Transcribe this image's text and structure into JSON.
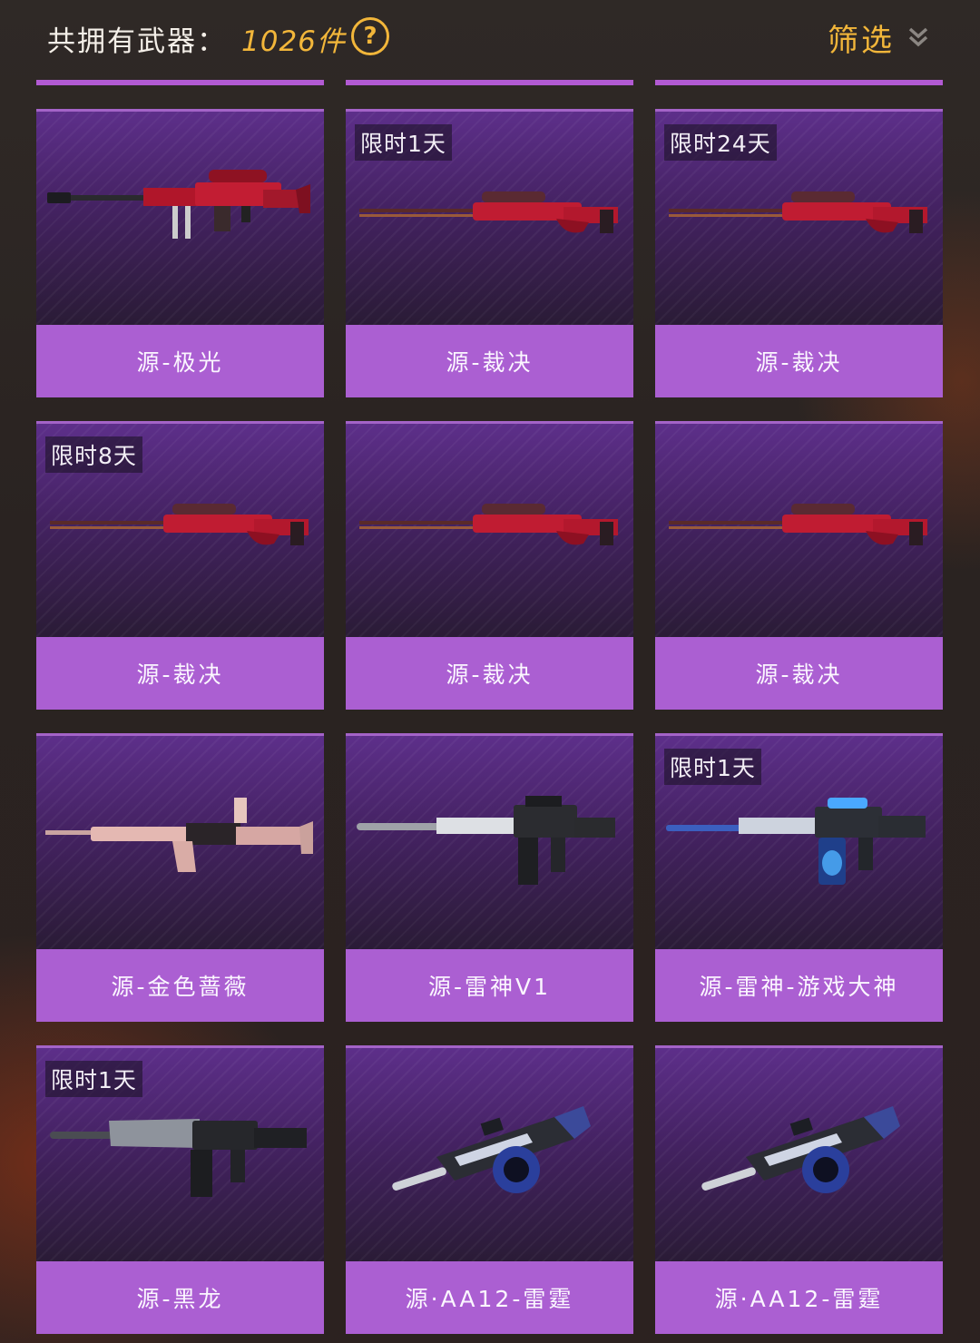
{
  "header": {
    "count_label": "共拥有武器：",
    "count_value": "1026件",
    "help_symbol": "?",
    "filter_label": "筛选"
  },
  "colors": {
    "accent_gold": "#f2b63a",
    "card_name_bg": "#ab5fd2",
    "card_top_bg": "#5d2f8a"
  },
  "weapons": [
    {
      "name": "源-极光",
      "badge": "",
      "icon": "red-heavy-sniper-rifle"
    },
    {
      "name": "源-裁决",
      "badge": "限时1天",
      "icon": "red-sniper-rifle"
    },
    {
      "name": "源-裁决",
      "badge": "限时24天",
      "icon": "red-sniper-rifle"
    },
    {
      "name": "源-裁决",
      "badge": "限时8天",
      "icon": "red-sniper-rifle"
    },
    {
      "name": "源-裁决",
      "badge": "",
      "icon": "red-sniper-rifle"
    },
    {
      "name": "源-裁决",
      "badge": "",
      "icon": "red-sniper-rifle"
    },
    {
      "name": "源-金色蔷薇",
      "badge": "",
      "icon": "rose-gold-assault-rifle"
    },
    {
      "name": "源-雷神V1",
      "badge": "",
      "icon": "dark-silver-assault-rifle"
    },
    {
      "name": "源-雷神-游戏大神",
      "badge": "限时1天",
      "icon": "blue-silver-assault-rifle"
    },
    {
      "name": "源-黑龙",
      "badge": "限时1天",
      "icon": "black-dragon-assault-rifle"
    },
    {
      "name": "源·AA12-雷霆",
      "badge": "",
      "icon": "blue-drum-shotgun"
    },
    {
      "name": "源·AA12-雷霆",
      "badge": "",
      "icon": "blue-drum-shotgun"
    }
  ]
}
